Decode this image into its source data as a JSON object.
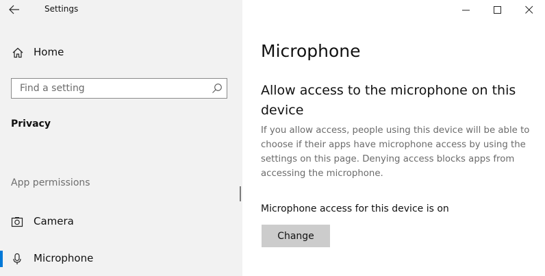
{
  "window": {
    "app_title": "Settings"
  },
  "sidebar": {
    "home_label": "Home",
    "search": {
      "placeholder": "Find a setting",
      "value": ""
    },
    "section_privacy": "Privacy",
    "section_app_permissions": "App permissions",
    "items": [
      {
        "label": "Camera",
        "icon": "camera-icon",
        "selected": false
      },
      {
        "label": "Microphone",
        "icon": "microphone-icon",
        "selected": true
      }
    ]
  },
  "content": {
    "page_title": "Microphone",
    "section_heading": "Allow access to the microphone on this device",
    "description": "If you allow access, people using this device will be able to choose if their apps have microphone access by using the settings on this page. Denying access blocks apps from accessing the microphone.",
    "status_text": "Microphone access for this device is on",
    "change_button_label": "Change"
  },
  "colors": {
    "sidebar_bg": "#f2f2f2",
    "accent": "#0078d7",
    "button_bg": "#cccccc",
    "secondary_text": "#6b6b6b"
  }
}
